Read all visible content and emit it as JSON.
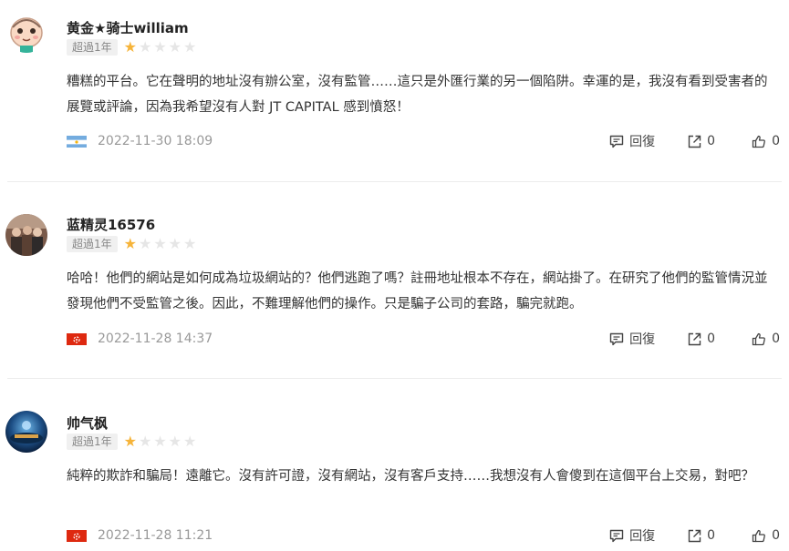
{
  "reviews": [
    {
      "username": "黄金★骑士william",
      "badge": "超過1年",
      "rating": 1,
      "content": "糟糕的平台。它在聲明的地址沒有辦公室，沒有監管……這只是外匯行業的另一個陷阱。幸運的是，我沒有看到受害者的展覽或評論，因為我希望沒有人對 JT CAPITAL 感到憤怒！",
      "flag": "argentina-flag",
      "date": "2022-11-30 18:09",
      "reply_label": "回復",
      "share_count": "0",
      "like_count": "0"
    },
    {
      "username": "蓝精灵16576",
      "badge": "超過1年",
      "rating": 1,
      "content": "哈哈！他們的網站是如何成為垃圾網站的？他們逃跑了嗎？註冊地址根本不存在，網站掛了。在研究了他們的監管情況並發現他們不受監管之後。因此，不難理解他們的操作。只是騙子公司的套路，騙完就跑。",
      "flag": "hong-kong-flag",
      "date": "2022-11-28 14:37",
      "reply_label": "回復",
      "share_count": "0",
      "like_count": "0"
    },
    {
      "username": "帅气枫",
      "badge": "超過1年",
      "rating": 1,
      "content": "純粹的欺詐和騙局！遠離它。沒有許可證，沒有網站，沒有客戶支持……我想沒有人會傻到在這個平台上交易，對吧？",
      "flag": "hong-kong-flag",
      "date": "2022-11-28 11:21",
      "reply_label": "回復",
      "share_count": "0",
      "like_count": "0"
    }
  ],
  "colors": {
    "star_on": "#f6b43a",
    "star_off": "#e6e6e6",
    "date": "#999999",
    "badge_bg": "#f0f0f0"
  }
}
